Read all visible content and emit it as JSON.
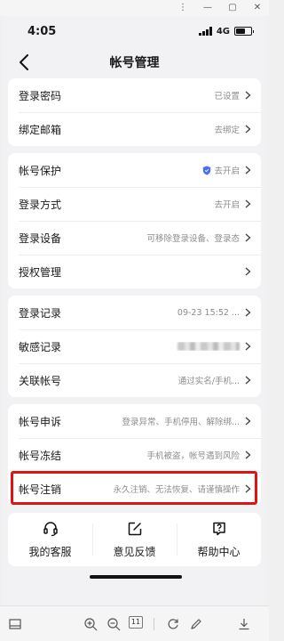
{
  "window": {
    "controls": [
      "⋮",
      "—",
      "▢",
      "✕"
    ]
  },
  "status_bar": {
    "time": "4:05",
    "network": "4G"
  },
  "nav": {
    "title": "帐号管理"
  },
  "groups": [
    [
      {
        "label": "登录密码",
        "value": "已设置"
      },
      {
        "label": "绑定邮箱",
        "value": "去绑定"
      }
    ],
    [
      {
        "label": "帐号保护",
        "value": "去开启",
        "icon": "shield-icon"
      },
      {
        "label": "登录方式",
        "value": "去开启"
      },
      {
        "label": "登录设备",
        "value": "可移除登录设备、登录态"
      },
      {
        "label": "授权管理",
        "value": ""
      }
    ],
    [
      {
        "label": "登录记录",
        "value": "09-23 15:52 ..."
      },
      {
        "label": "敏感记录",
        "value": ""
      },
      {
        "label": "关联帐号",
        "value": "通过实名/手机..."
      }
    ],
    [
      {
        "label": "帐号申诉",
        "value": "登录异常、手机停用、解除绑..."
      },
      {
        "label": "帐号冻结",
        "value": "手机被盗，帐号遇到风险"
      },
      {
        "label": "帐号注销",
        "value": "永久注销、无法恢复、请谨慎操作"
      }
    ]
  ],
  "bottom_actions": [
    {
      "label": "我的客服",
      "icon": "headset-icon"
    },
    {
      "label": "意见反馈",
      "icon": "edit-icon"
    },
    {
      "label": "帮助中心",
      "icon": "help-icon"
    }
  ],
  "toolbar": {
    "page_number": "11"
  },
  "colors": {
    "highlight": "#e01313",
    "shield": "#4a6cf7"
  }
}
